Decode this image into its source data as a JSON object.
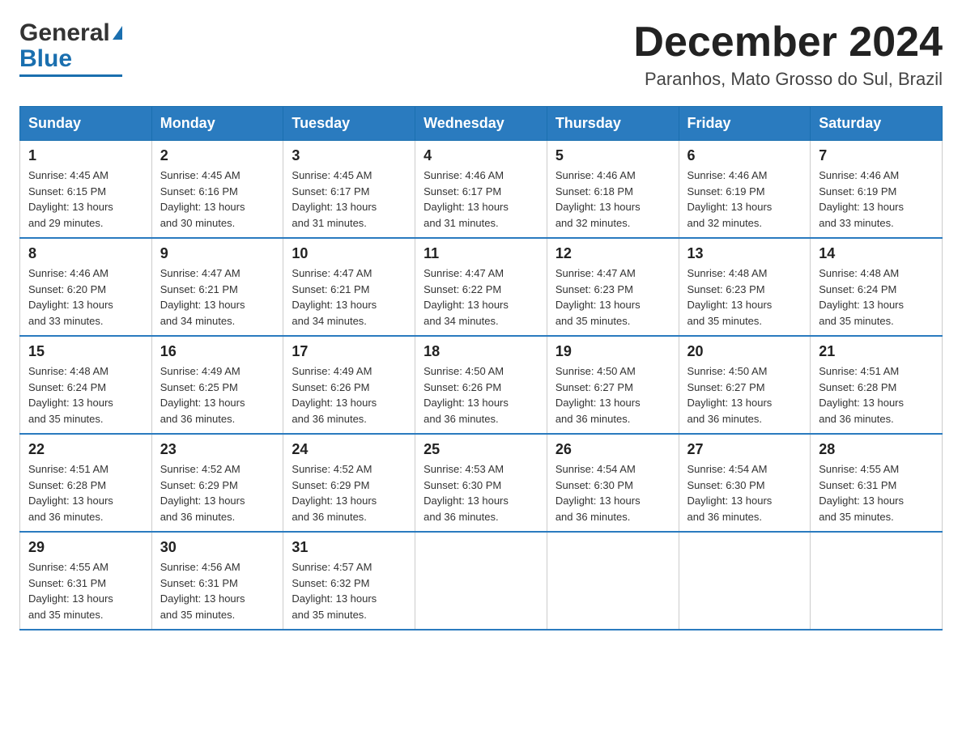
{
  "logo": {
    "general": "General",
    "blue": "Blue"
  },
  "title": {
    "month": "December 2024",
    "location": "Paranhos, Mato Grosso do Sul, Brazil"
  },
  "weekdays": [
    "Sunday",
    "Monday",
    "Tuesday",
    "Wednesday",
    "Thursday",
    "Friday",
    "Saturday"
  ],
  "weeks": [
    [
      {
        "day": "1",
        "sunrise": "4:45 AM",
        "sunset": "6:15 PM",
        "daylight": "13 hours and 29 minutes."
      },
      {
        "day": "2",
        "sunrise": "4:45 AM",
        "sunset": "6:16 PM",
        "daylight": "13 hours and 30 minutes."
      },
      {
        "day": "3",
        "sunrise": "4:45 AM",
        "sunset": "6:17 PM",
        "daylight": "13 hours and 31 minutes."
      },
      {
        "day": "4",
        "sunrise": "4:46 AM",
        "sunset": "6:17 PM",
        "daylight": "13 hours and 31 minutes."
      },
      {
        "day": "5",
        "sunrise": "4:46 AM",
        "sunset": "6:18 PM",
        "daylight": "13 hours and 32 minutes."
      },
      {
        "day": "6",
        "sunrise": "4:46 AM",
        "sunset": "6:19 PM",
        "daylight": "13 hours and 32 minutes."
      },
      {
        "day": "7",
        "sunrise": "4:46 AM",
        "sunset": "6:19 PM",
        "daylight": "13 hours and 33 minutes."
      }
    ],
    [
      {
        "day": "8",
        "sunrise": "4:46 AM",
        "sunset": "6:20 PM",
        "daylight": "13 hours and 33 minutes."
      },
      {
        "day": "9",
        "sunrise": "4:47 AM",
        "sunset": "6:21 PM",
        "daylight": "13 hours and 34 minutes."
      },
      {
        "day": "10",
        "sunrise": "4:47 AM",
        "sunset": "6:21 PM",
        "daylight": "13 hours and 34 minutes."
      },
      {
        "day": "11",
        "sunrise": "4:47 AM",
        "sunset": "6:22 PM",
        "daylight": "13 hours and 34 minutes."
      },
      {
        "day": "12",
        "sunrise": "4:47 AM",
        "sunset": "6:23 PM",
        "daylight": "13 hours and 35 minutes."
      },
      {
        "day": "13",
        "sunrise": "4:48 AM",
        "sunset": "6:23 PM",
        "daylight": "13 hours and 35 minutes."
      },
      {
        "day": "14",
        "sunrise": "4:48 AM",
        "sunset": "6:24 PM",
        "daylight": "13 hours and 35 minutes."
      }
    ],
    [
      {
        "day": "15",
        "sunrise": "4:48 AM",
        "sunset": "6:24 PM",
        "daylight": "13 hours and 35 minutes."
      },
      {
        "day": "16",
        "sunrise": "4:49 AM",
        "sunset": "6:25 PM",
        "daylight": "13 hours and 36 minutes."
      },
      {
        "day": "17",
        "sunrise": "4:49 AM",
        "sunset": "6:26 PM",
        "daylight": "13 hours and 36 minutes."
      },
      {
        "day": "18",
        "sunrise": "4:50 AM",
        "sunset": "6:26 PM",
        "daylight": "13 hours and 36 minutes."
      },
      {
        "day": "19",
        "sunrise": "4:50 AM",
        "sunset": "6:27 PM",
        "daylight": "13 hours and 36 minutes."
      },
      {
        "day": "20",
        "sunrise": "4:50 AM",
        "sunset": "6:27 PM",
        "daylight": "13 hours and 36 minutes."
      },
      {
        "day": "21",
        "sunrise": "4:51 AM",
        "sunset": "6:28 PM",
        "daylight": "13 hours and 36 minutes."
      }
    ],
    [
      {
        "day": "22",
        "sunrise": "4:51 AM",
        "sunset": "6:28 PM",
        "daylight": "13 hours and 36 minutes."
      },
      {
        "day": "23",
        "sunrise": "4:52 AM",
        "sunset": "6:29 PM",
        "daylight": "13 hours and 36 minutes."
      },
      {
        "day": "24",
        "sunrise": "4:52 AM",
        "sunset": "6:29 PM",
        "daylight": "13 hours and 36 minutes."
      },
      {
        "day": "25",
        "sunrise": "4:53 AM",
        "sunset": "6:30 PM",
        "daylight": "13 hours and 36 minutes."
      },
      {
        "day": "26",
        "sunrise": "4:54 AM",
        "sunset": "6:30 PM",
        "daylight": "13 hours and 36 minutes."
      },
      {
        "day": "27",
        "sunrise": "4:54 AM",
        "sunset": "6:30 PM",
        "daylight": "13 hours and 36 minutes."
      },
      {
        "day": "28",
        "sunrise": "4:55 AM",
        "sunset": "6:31 PM",
        "daylight": "13 hours and 35 minutes."
      }
    ],
    [
      {
        "day": "29",
        "sunrise": "4:55 AM",
        "sunset": "6:31 PM",
        "daylight": "13 hours and 35 minutes."
      },
      {
        "day": "30",
        "sunrise": "4:56 AM",
        "sunset": "6:31 PM",
        "daylight": "13 hours and 35 minutes."
      },
      {
        "day": "31",
        "sunrise": "4:57 AM",
        "sunset": "6:32 PM",
        "daylight": "13 hours and 35 minutes."
      },
      null,
      null,
      null,
      null
    ]
  ],
  "labels": {
    "sunrise": "Sunrise:",
    "sunset": "Sunset:",
    "daylight": "Daylight:"
  }
}
